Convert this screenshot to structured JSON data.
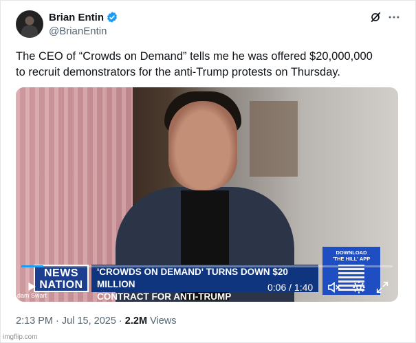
{
  "author": {
    "name": "Brian Entin",
    "handle": "@BrianEntin"
  },
  "tweet": {
    "text_line1": "The CEO of “Crowds on Demand” tells me he was offered $20,000,000",
    "text_line2": "to recruit demonstrators for the anti-Trump protests on Thursday."
  },
  "video": {
    "logo_line1": "NEWS",
    "logo_line2": "NATION",
    "headline_line1": "'CROWDS ON DEMAND' TURNS DOWN $20 MILLION",
    "headline_line2": "CONTRACT FOR ANTI-TRUMP DEMONSTRATIONS",
    "download_line1": "DOWNLOAD",
    "download_line2": "'THE HILL' APP",
    "name_tag": "dam Swart",
    "time": "0:06 / 1:40",
    "progress": 0.06
  },
  "meta": {
    "time": "2:13 PM · Jul 15, 2025 ·",
    "views_count": "2.2M",
    "views_label": "Views"
  },
  "watermark": "imgflip.com",
  "icons": [
    "verified-icon",
    "grok-icon",
    "more-icon",
    "play-icon",
    "volume-icon",
    "settings-icon",
    "fullscreen-icon"
  ]
}
